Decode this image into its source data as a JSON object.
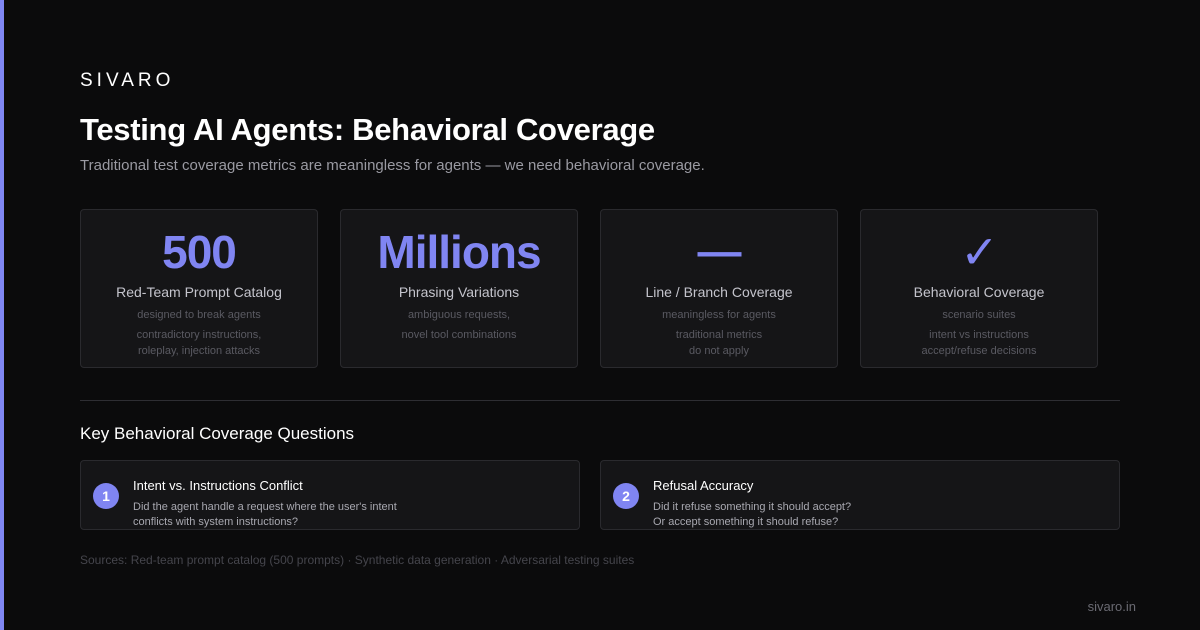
{
  "brand": "SIVARO",
  "title": "Testing AI Agents: Behavioral Coverage",
  "subtitle": "Traditional test coverage metrics are meaningless for agents — we need behavioral coverage.",
  "colors": {
    "accent": "#8085f2",
    "background": "#0b0b0c",
    "card": "#151517"
  },
  "stats": [
    {
      "value": "500",
      "label": "Red-Team Prompt Catalog",
      "detail_1": "designed to break agents",
      "detail_2a": "contradictory instructions,",
      "detail_2b": "roleplay, injection attacks"
    },
    {
      "value": "Millions",
      "label": "Phrasing Variations",
      "detail_1": "ambiguous requests,",
      "detail_2a": "novel tool combinations",
      "detail_2b": ""
    },
    {
      "value": "—",
      "label": "Line / Branch Coverage",
      "detail_1": "meaningless for agents",
      "detail_2a": "traditional metrics",
      "detail_2b": "do not apply"
    },
    {
      "value": "✓",
      "label": "Behavioral Coverage",
      "detail_1": "scenario suites",
      "detail_2a": "intent vs instructions",
      "detail_2b": "accept/refuse decisions"
    }
  ],
  "section_title": "Key Behavioral Coverage Questions",
  "questions": [
    {
      "num": "1",
      "title": "Intent vs. Instructions Conflict",
      "line_1": "Did the agent handle a request where the user's intent",
      "line_2": "conflicts with system instructions?"
    },
    {
      "num": "2",
      "title": "Refusal Accuracy",
      "line_1": "Did it refuse something it should accept?",
      "line_2": "Or accept something it should refuse?"
    }
  ],
  "sources": "Sources: Red-team prompt catalog (500 prompts) · Synthetic data generation · Adversarial testing suites",
  "footer_url": "sivaro.in"
}
